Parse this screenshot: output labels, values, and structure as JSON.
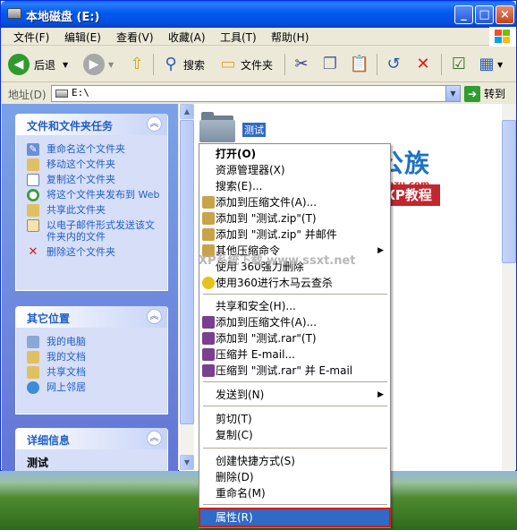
{
  "window": {
    "title": "本地磁盘 (E:)"
  },
  "titlebar": {
    "minimize": "_",
    "maximize": "□",
    "close": "×"
  },
  "menu": [
    "文件(F)",
    "编辑(E)",
    "查看(V)",
    "收藏(A)",
    "工具(T)",
    "帮助(H)"
  ],
  "toolbar": {
    "back": "后退",
    "search": "搜索",
    "folders": "文件夹"
  },
  "address": {
    "label": "地址(D)",
    "value": "E:\\",
    "go": "转到"
  },
  "tasks_panel": {
    "title": "文件和文件夹任务",
    "items": [
      "重命名这个文件夹",
      "移动这个文件夹",
      "复制这个文件夹",
      "将这个文件夹发布到 Web",
      "共享此文件夹",
      "以电子邮件形式发送该文件夹内的文件",
      "删除这个文件夹"
    ]
  },
  "other_panel": {
    "title": "其它位置",
    "items": [
      "我的电脑",
      "我的文档",
      "共享文档",
      "网上邻居"
    ]
  },
  "details_panel": {
    "title": "详细信息",
    "name": "测试"
  },
  "folder": {
    "name": "测试"
  },
  "watermark": {
    "brand": "办公族",
    "url": "Officezu.com",
    "winxp": "WinXP教程",
    "ssxt": "XP系统下载 www.ssxt.net"
  },
  "context_menu": {
    "items": [
      "打开(O)",
      "资源管理器(X)",
      "搜索(E)...",
      "添加到压缩文件(A)...",
      "添加到 \"测试.zip\"(T)",
      "添加到 \"测试.zip\" 并邮件",
      "其他压缩命令",
      "使用 360强力删除",
      "使用360进行木马云查杀",
      "共享和安全(H)...",
      "添加到压缩文件(A)...",
      "添加到 \"测试.rar\"(T)",
      "压缩并 E-mail...",
      "压缩到 \"测试.rar\" 并 E-mail",
      "发送到(N)",
      "剪切(T)",
      "复制(C)",
      "创建快捷方式(S)",
      "删除(D)",
      "重命名(M)",
      "属性(R)"
    ]
  }
}
